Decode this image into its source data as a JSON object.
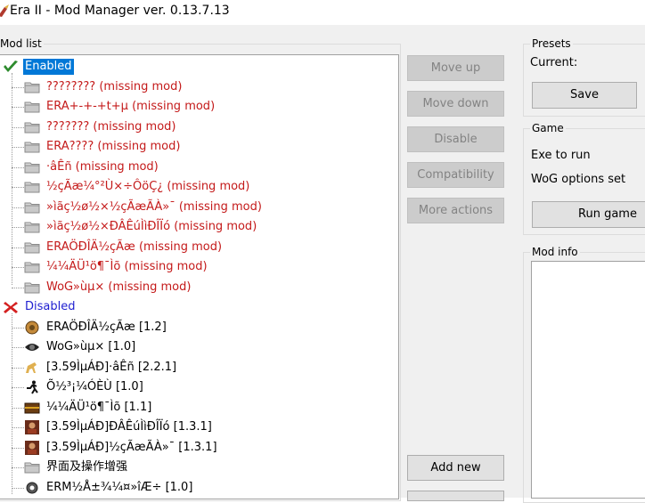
{
  "window": {
    "title": "Era II - Mod Manager ver. 0.13.7.13"
  },
  "modlist": {
    "caption": "Mod list",
    "enabled_label": "Enabled",
    "disabled_label": "Disabled",
    "enabled_items": [
      "???????? (missing mod)",
      "ERA+-+-+t+µ (missing mod)",
      "??????? (missing mod)",
      "ERA???? (missing mod)",
      "·âÊñ (missing mod)",
      "½çÃæ¼°²Ù×÷ÔöÇ¿ (missing mod)",
      "»ìãç½ø½×½çÃæÃÀ»¯ (missing mod)",
      "»ìãç½ø½×ÐÂÊúÌìÐÎÏó (missing mod)",
      "ERAÖÐÎÄ½çÃæ (missing mod)",
      "¼¼ÄÜ¹ö¶¯Ìõ (missing mod)",
      "WoG»ùµ× (missing mod)"
    ],
    "disabled_items": [
      "ERAÖÐÎÄ½çÃæ [1.2]",
      "WoG»ùµ× [1.0]",
      "[3.59ÌµÁÐ]·âÊñ [2.2.1]",
      "Õ½³¡¼ÓÈÙ [1.0]",
      "¼¼ÄÜ¹ö¶¯Ìõ [1.1]",
      "[3.59ÌµÁÐ]ÐÂÊúÌìÐÎÏó [1.3.1]",
      "[3.59ÌµÁÐ]½çÃæÃÀ»¯ [1.3.1]",
      "界面及操作增强",
      "ERM½Å±¾¼¤»îÆ÷ [1.0]"
    ],
    "disabled_icons": [
      "book-icon",
      "eye-icon",
      "horse-icon",
      "running-man-icon",
      "chest-icon",
      "hero-portrait-icon",
      "hero-portrait-icon",
      "folder-icon",
      "gear-icon"
    ]
  },
  "actions": {
    "move_up": "Move up",
    "move_down": "Move down",
    "disable": "Disable",
    "compatibility": "Compatibility",
    "more_actions": "More actions",
    "add_new": "Add new"
  },
  "presets": {
    "caption": "Presets",
    "current_label": "Current:",
    "save": "Save"
  },
  "game": {
    "caption": "Game",
    "exe_label": "Exe to run",
    "wog_label": "WoG options set",
    "run": "Run game"
  },
  "modinfo": {
    "caption": "Mod info"
  },
  "colors": {
    "selection": "#0078d7",
    "missing": "#c41a1a",
    "disabled_header": "#1f1fd0"
  }
}
